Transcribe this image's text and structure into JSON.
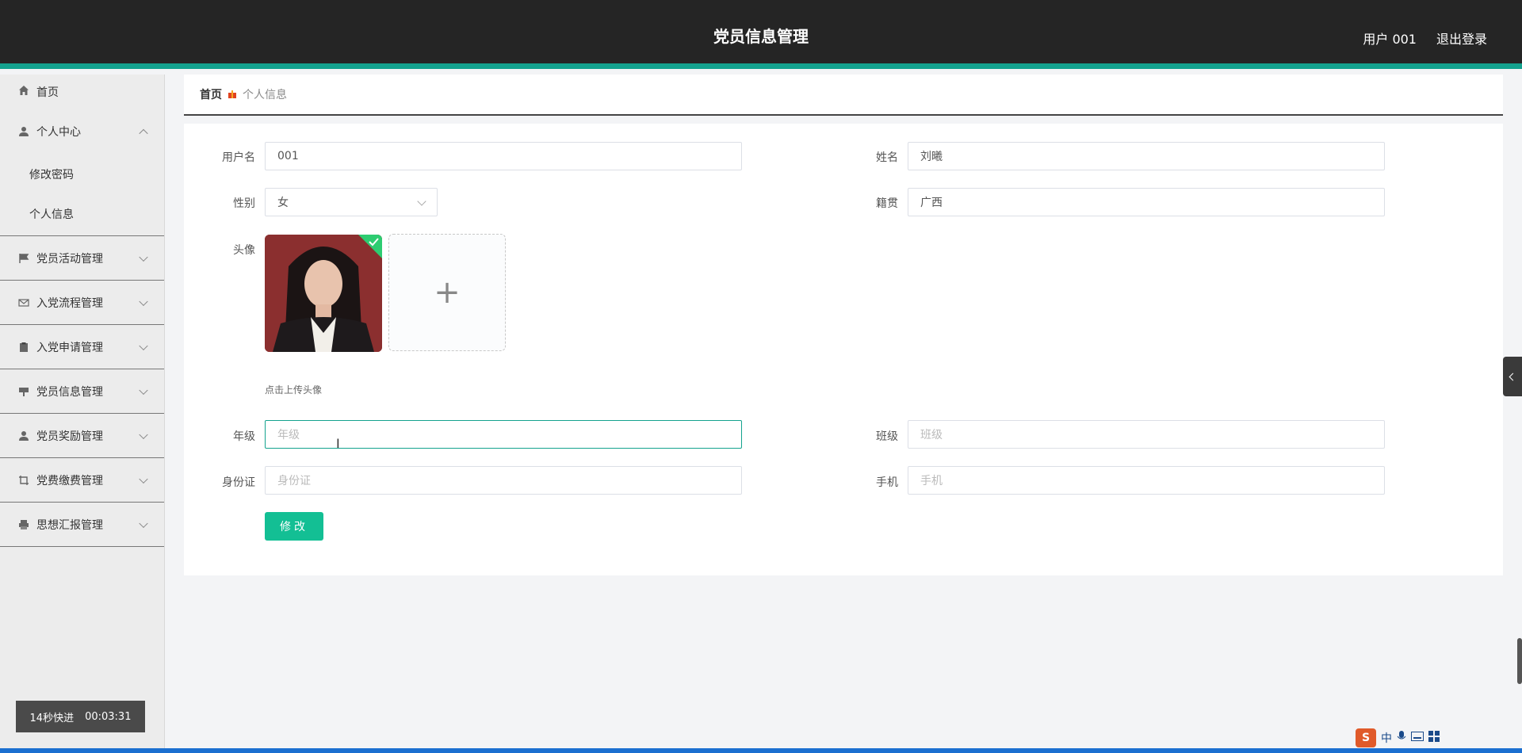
{
  "header": {
    "title": "党员信息管理",
    "user": "用户 001",
    "logout": "退出登录"
  },
  "sidebar": {
    "home": "首页",
    "personal_center": "个人中心",
    "sub_items": [
      "修改密码",
      "个人信息"
    ],
    "items": [
      {
        "label": "党员活动管理",
        "icon": "flag-icon"
      },
      {
        "label": "入党流程管理",
        "icon": "mail-icon"
      },
      {
        "label": "入党申请管理",
        "icon": "clipboard-icon"
      },
      {
        "label": "党员信息管理",
        "icon": "sign-icon"
      },
      {
        "label": "党员奖励管理",
        "icon": "user-icon"
      },
      {
        "label": "党费缴费管理",
        "icon": "crop-icon"
      },
      {
        "label": "思想汇报管理",
        "icon": "printer-icon"
      }
    ],
    "timer_label": "14秒快进",
    "timer_value": "00:03:31"
  },
  "breadcrumb": {
    "home": "首页",
    "current": "个人信息"
  },
  "form": {
    "username_label": "用户名",
    "username_value": "001",
    "name_label": "姓名",
    "name_value": "刘曦",
    "gender_label": "性别",
    "gender_value": "女",
    "hometown_label": "籍贯",
    "hometown_value": "广西",
    "avatar_label": "头像",
    "upload_plus": "+",
    "upload_hint": "点击上传头像",
    "grade_label": "年级",
    "grade_placeholder": "年级",
    "class_label": "班级",
    "class_placeholder": "班级",
    "idcard_label": "身份证",
    "idcard_placeholder": "身份证",
    "phone_label": "手机",
    "phone_placeholder": "手机",
    "submit_label": "修改"
  },
  "ime": {
    "logo": "S",
    "lang": "中"
  },
  "colors": {
    "header_bg": "#252525",
    "accent": "#13a28e",
    "button": "#13bf94"
  }
}
